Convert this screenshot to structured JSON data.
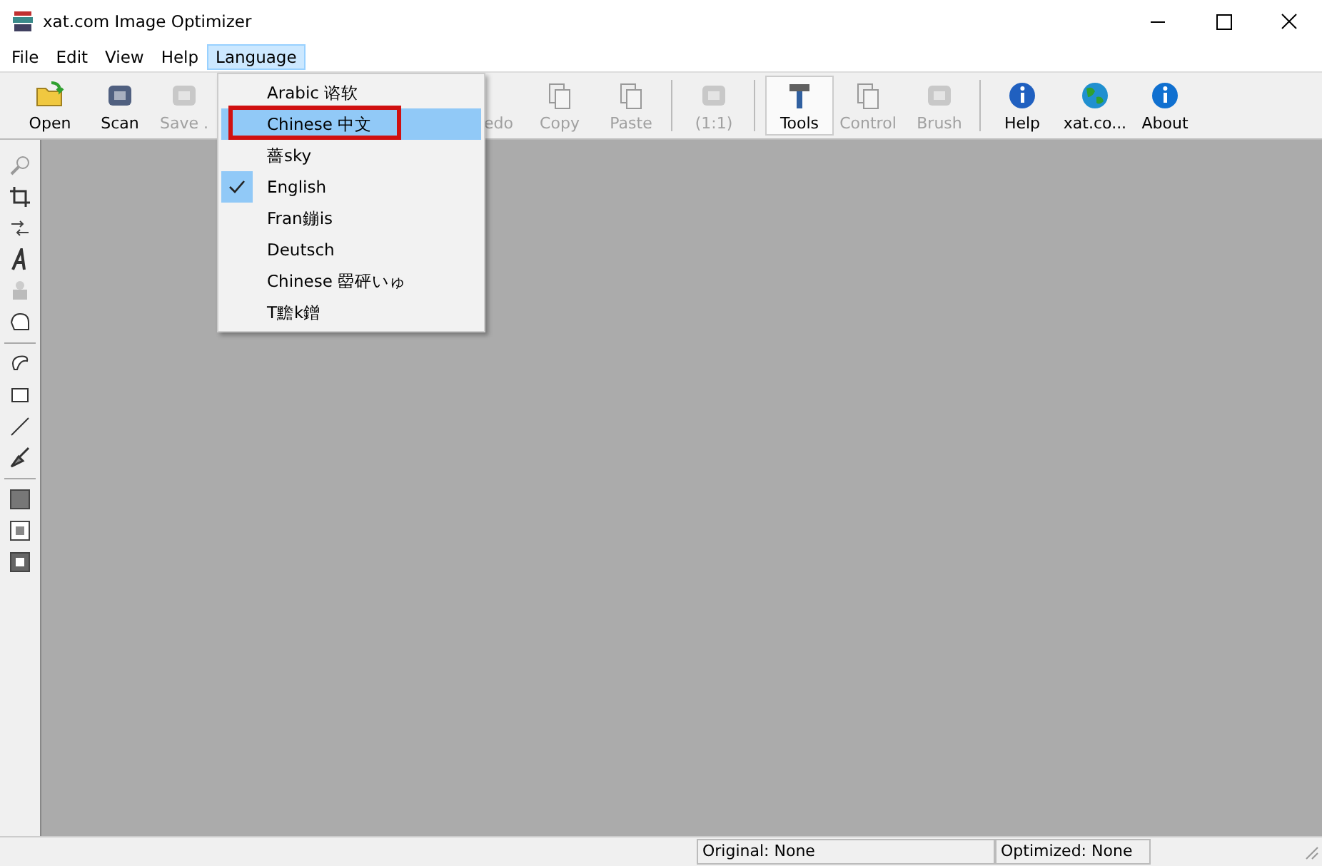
{
  "window": {
    "title": "xat.com  Image Optimizer"
  },
  "menu_bar": [
    {
      "label": "File",
      "selected": false
    },
    {
      "label": "Edit",
      "selected": false
    },
    {
      "label": "View",
      "selected": false
    },
    {
      "label": "Help",
      "selected": false
    },
    {
      "label": "Language",
      "selected": true
    }
  ],
  "toolbar": [
    {
      "label": "Open",
      "disabled": false,
      "pressed": false
    },
    {
      "label": "Scan",
      "disabled": false,
      "pressed": false
    },
    {
      "label": "Save .",
      "disabled": true,
      "pressed": false
    },
    {
      "label": "edo",
      "disabled": true,
      "pressed": false
    },
    {
      "label": "Copy",
      "disabled": true,
      "pressed": false
    },
    {
      "label": "Paste",
      "disabled": true,
      "pressed": false
    },
    {
      "label": "(1:1)",
      "disabled": true,
      "pressed": false
    },
    {
      "label": "Tools",
      "disabled": false,
      "pressed": true
    },
    {
      "label": "Control",
      "disabled": true,
      "pressed": false
    },
    {
      "label": "Brush",
      "disabled": true,
      "pressed": false
    },
    {
      "label": "Help",
      "disabled": false,
      "pressed": false
    },
    {
      "label": "xat.co...",
      "disabled": false,
      "pressed": false
    },
    {
      "label": "About",
      "disabled": false,
      "pressed": false
    }
  ],
  "language_menu": [
    {
      "label": "Arabic 谘软",
      "selected": false,
      "checked": false,
      "outlined": false
    },
    {
      "label": "Chinese 中文",
      "selected": true,
      "checked": false,
      "outlined": true
    },
    {
      "label": "薔sky",
      "selected": false,
      "checked": false,
      "outlined": false
    },
    {
      "label": "English",
      "selected": false,
      "checked": true,
      "outlined": false
    },
    {
      "label": "Fran鏰is",
      "selected": false,
      "checked": false,
      "outlined": false
    },
    {
      "label": "Deutsch",
      "selected": false,
      "checked": false,
      "outlined": false
    },
    {
      "label": "Chinese 罶砰いゅ",
      "selected": false,
      "checked": false,
      "outlined": false
    },
    {
      "label": "T黵k鏳",
      "selected": false,
      "checked": false,
      "outlined": false
    }
  ],
  "status_bar": [
    "Original: None",
    "Optimized: None"
  ]
}
